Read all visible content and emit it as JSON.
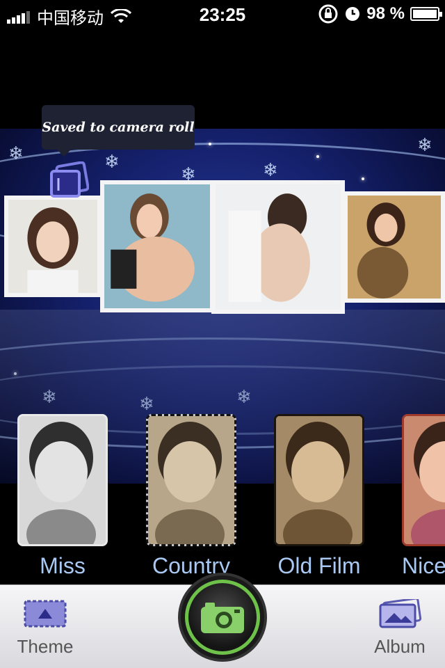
{
  "status_bar": {
    "carrier": "中国移动",
    "time": "23:25",
    "battery": "98 %",
    "battery_level": 0.98
  },
  "toast": {
    "message": "Saved to camera roll"
  },
  "filters": [
    {
      "label": "Miss"
    },
    {
      "label": "Country"
    },
    {
      "label": "Old Film"
    },
    {
      "label": "Nice"
    }
  ],
  "tabbar": {
    "theme_label": "Theme",
    "album_label": "Album"
  },
  "colors": {
    "accent_green": "#6ec24a",
    "icon_purple": "#5a5ab0",
    "filter_label": "#a9c8f2"
  },
  "icons": {
    "theme": "theme-icon",
    "album": "album-icon",
    "camera": "camera-icon",
    "save": "save-to-roll-icon"
  }
}
